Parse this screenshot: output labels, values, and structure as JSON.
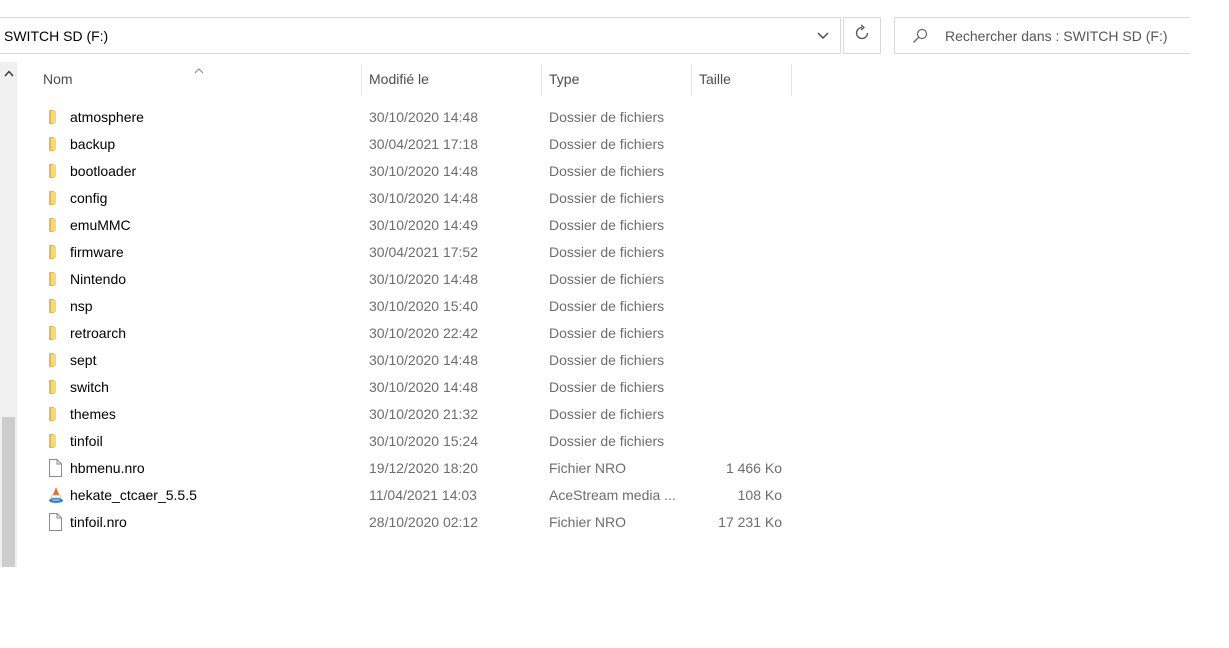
{
  "address_bar": {
    "path": "SWITCH SD (F:)"
  },
  "search": {
    "placeholder": "Rechercher dans : SWITCH SD (F:)"
  },
  "columns": {
    "name": "Nom",
    "modified": "Modifié le",
    "type": "Type",
    "size": "Taille"
  },
  "files": [
    {
      "name": "atmosphere",
      "modified": "30/10/2020 14:48",
      "type": "Dossier de fichiers",
      "size": "",
      "icon": "folder-icon"
    },
    {
      "name": "backup",
      "modified": "30/04/2021 17:18",
      "type": "Dossier de fichiers",
      "size": "",
      "icon": "folder-icon"
    },
    {
      "name": "bootloader",
      "modified": "30/10/2020 14:48",
      "type": "Dossier de fichiers",
      "size": "",
      "icon": "folder-icon"
    },
    {
      "name": "config",
      "modified": "30/10/2020 14:48",
      "type": "Dossier de fichiers",
      "size": "",
      "icon": "folder-icon"
    },
    {
      "name": "emuMMC",
      "modified": "30/10/2020 14:49",
      "type": "Dossier de fichiers",
      "size": "",
      "icon": "folder-icon"
    },
    {
      "name": "firmware",
      "modified": "30/04/2021 17:52",
      "type": "Dossier de fichiers",
      "size": "",
      "icon": "folder-icon"
    },
    {
      "name": "Nintendo",
      "modified": "30/10/2020 14:48",
      "type": "Dossier de fichiers",
      "size": "",
      "icon": "folder-icon"
    },
    {
      "name": "nsp",
      "modified": "30/10/2020 15:40",
      "type": "Dossier de fichiers",
      "size": "",
      "icon": "folder-icon"
    },
    {
      "name": "retroarch",
      "modified": "30/10/2020 22:42",
      "type": "Dossier de fichiers",
      "size": "",
      "icon": "folder-icon"
    },
    {
      "name": "sept",
      "modified": "30/10/2020 14:48",
      "type": "Dossier de fichiers",
      "size": "",
      "icon": "folder-icon"
    },
    {
      "name": "switch",
      "modified": "30/10/2020 14:48",
      "type": "Dossier de fichiers",
      "size": "",
      "icon": "folder-icon"
    },
    {
      "name": "themes",
      "modified": "30/10/2020 21:32",
      "type": "Dossier de fichiers",
      "size": "",
      "icon": "folder-icon"
    },
    {
      "name": "tinfoil",
      "modified": "30/10/2020 15:24",
      "type": "Dossier de fichiers",
      "size": "",
      "icon": "folder-icon"
    },
    {
      "name": "hbmenu.nro",
      "modified": "19/12/2020 18:20",
      "type": "Fichier NRO",
      "size": "1 466 Ko",
      "icon": "file-icon"
    },
    {
      "name": "hekate_ctcaer_5.5.5",
      "modified": "11/04/2021 14:03",
      "type": "AceStream media ...",
      "size": "108 Ko",
      "icon": "acestream-icon"
    },
    {
      "name": "tinfoil.nro",
      "modified": "28/10/2020 02:12",
      "type": "Fichier NRO",
      "size": "17 231 Ko",
      "icon": "file-icon"
    }
  ],
  "colors": {
    "folder": "#f8d775",
    "folder_dark": "#e8b84a",
    "text_muted": "#6d6d6d"
  }
}
